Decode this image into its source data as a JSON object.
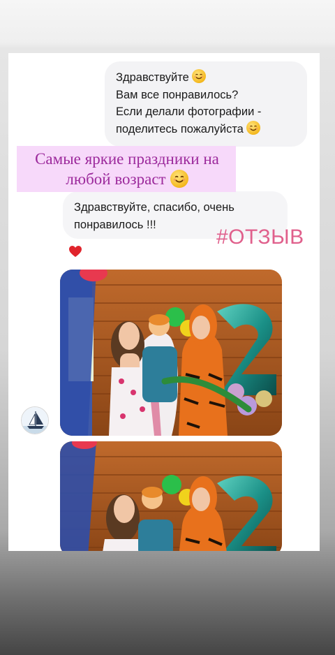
{
  "chat": {
    "incoming": {
      "lines": [
        "Здравствуйте",
        "Вам все понравилось?",
        "Если делали фотографии -",
        "поделитесь пожалуйста"
      ]
    },
    "overlay": {
      "line1": "Самые яркие праздники на",
      "line2": "любой возраст"
    },
    "reply": {
      "line1": "Здравствуйте, спасибо, очень",
      "line2": "понравилось !!!"
    },
    "hashtag": "#ОТЗЫВ",
    "reaction_icon": "heart-icon",
    "emoji_icon": "smiling-face-icon"
  },
  "photos": [
    {
      "icon": "party-photo-icon"
    },
    {
      "icon": "party-photo-icon"
    }
  ],
  "colors": {
    "overlay_bg": "#f7d9fa",
    "overlay_text": "#9c2a9c",
    "hashtag": "#e0608c",
    "bubble_bg": "#f3f3f5",
    "heart": "#e0242c"
  }
}
